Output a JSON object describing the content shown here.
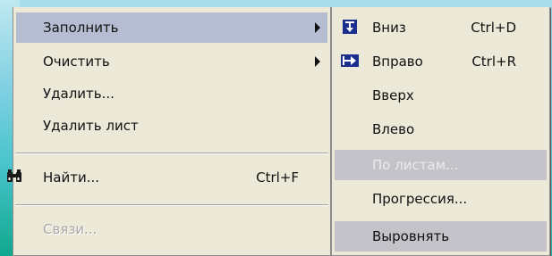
{
  "main_menu": {
    "items": [
      {
        "label": "Заполнить",
        "shortcut": "",
        "submenu": true
      },
      {
        "label": "Очистить",
        "shortcut": "",
        "submenu": true
      },
      {
        "label": "Удалить...",
        "shortcut": ""
      },
      {
        "label": "Удалить лист",
        "shortcut": ""
      },
      {
        "label": "Найти...",
        "shortcut": "Ctrl+F",
        "icon": "binoculars-icon"
      },
      {
        "label": "Связи...",
        "shortcut": "",
        "disabled": true
      }
    ]
  },
  "sub_menu": {
    "items": [
      {
        "label": "Вниз",
        "shortcut": "Ctrl+D",
        "icon": "fill-down-icon"
      },
      {
        "label": "Вправо",
        "shortcut": "Ctrl+R",
        "icon": "fill-right-icon"
      },
      {
        "label": "Вверх",
        "shortcut": ""
      },
      {
        "label": "Влево",
        "shortcut": ""
      },
      {
        "label": "По листам...",
        "shortcut": "",
        "disabled": true
      },
      {
        "label": "Прогрессия...",
        "shortcut": ""
      },
      {
        "label": "Выровнять",
        "shortcut": ""
      }
    ]
  },
  "colors": {
    "menu_bg": "#ece9d8",
    "selected_bg": "#b6bdd2",
    "icon_blue": "#1b2f8f"
  }
}
